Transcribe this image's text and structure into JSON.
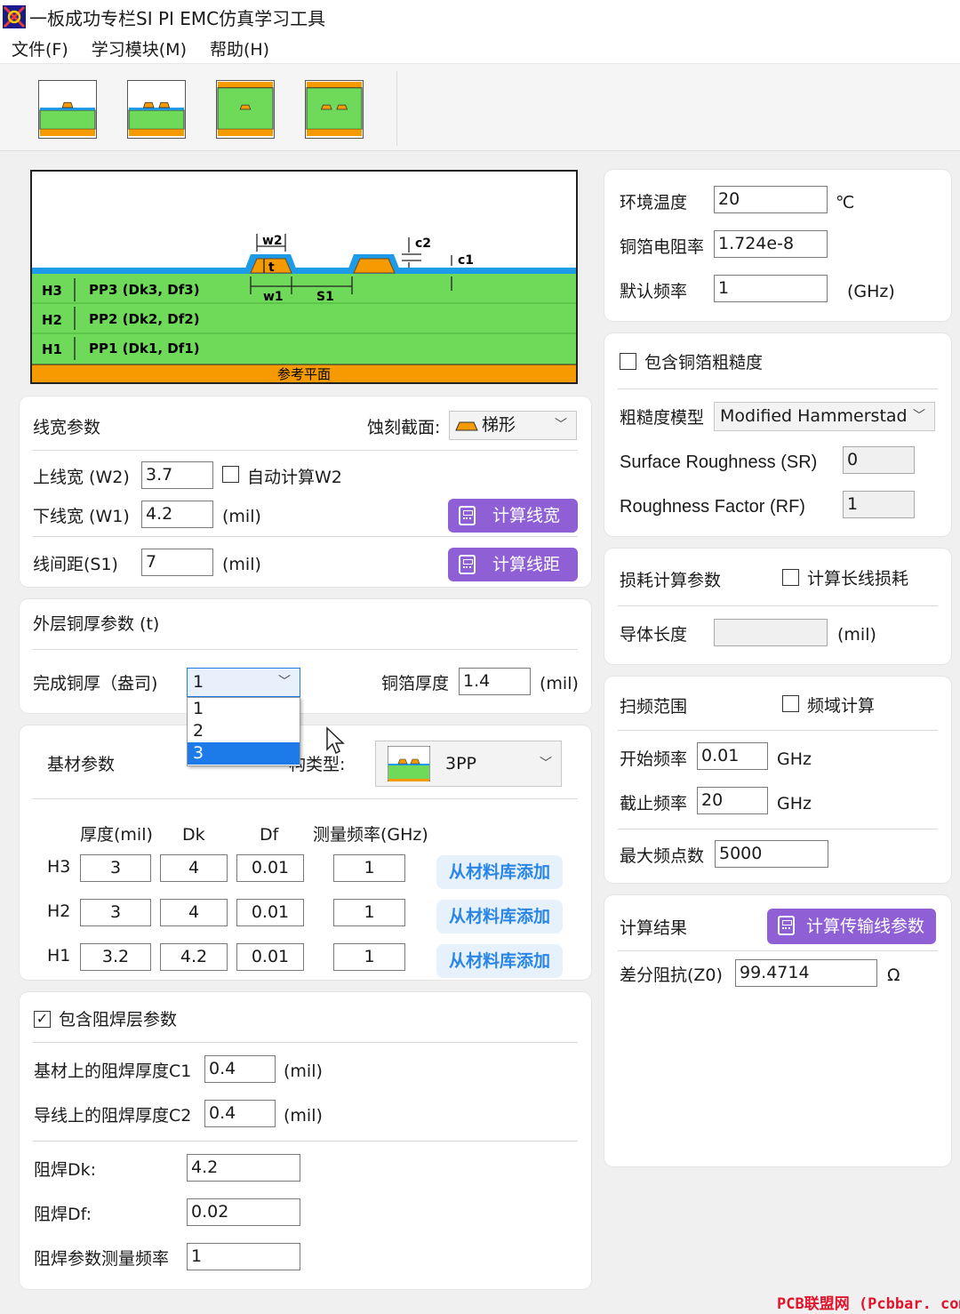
{
  "window": {
    "title": "一板成功专栏SI PI EMC仿真学习工具"
  },
  "menu": [
    "文件(F)",
    "学习模块(M)",
    "帮助(H)"
  ],
  "diagram": {
    "labels": {
      "w2": "w2",
      "t": "t",
      "c2": "c2",
      "c1": "c1",
      "w1": "w1",
      "s1": "S1"
    },
    "layers": [
      {
        "id": "H3",
        "name": "PP3 (Dk3, Df3)"
      },
      {
        "id": "H2",
        "name": "PP2 (Dk2, Df2)"
      },
      {
        "id": "H1",
        "name": "PP1 (Dk1, Df1)"
      }
    ],
    "ref_plane": "参考平面"
  },
  "line_width": {
    "title": "线宽参数",
    "etch_label": "蚀刻截面:",
    "etch_value": "梯形",
    "w2_label": "上线宽 (W2)",
    "w2_value": "3.7",
    "auto_w2": "自动计算W2",
    "w1_label": "下线宽 (W1)",
    "w1_value": "4.2",
    "unit": "(mil)",
    "calc_width": "计算线宽",
    "s1_label": "线间距(S1)",
    "s1_value": "7",
    "calc_spacing": "计算线距"
  },
  "copper": {
    "title": "外层铜厚参数 (t)",
    "finish_label": "完成铜厚（盎司)",
    "finish_value": "1",
    "foil_label": "铜箔厚度",
    "foil_value": "1.4",
    "unit": "(mil)",
    "dropdown_options": [
      "1",
      "2",
      "3"
    ]
  },
  "substrate": {
    "title": "基材参数",
    "structure_label": "叠构类型:",
    "structure_visible": "构类型:",
    "structure_value": "3PP",
    "columns": [
      "厚度(mil)",
      "Dk",
      "Df",
      "测量频率(GHz)"
    ],
    "rows": [
      {
        "layer": "H3",
        "thickness": "3",
        "dk": "4",
        "df": "0.01",
        "freq": "1"
      },
      {
        "layer": "H2",
        "thickness": "3",
        "dk": "4",
        "df": "0.01",
        "freq": "1"
      },
      {
        "layer": "H1",
        "thickness": "3.2",
        "dk": "4.2",
        "df": "0.01",
        "freq": "1"
      }
    ],
    "add_button": "从材料库添加"
  },
  "solder_mask": {
    "include": "包含阻焊层参数",
    "c1_label": "基材上的阻焊厚度C1",
    "c1_value": "0.4",
    "c2_label": "导线上的阻焊厚度C2",
    "c2_value": "0.4",
    "unit": "(mil)",
    "dk_label": "阻焊Dk:",
    "dk_value": "4.2",
    "df_label": "阻焊Df:",
    "df_value": "0.02",
    "freq_label": "阻焊参数测量频率",
    "freq_value": "1"
  },
  "environment": {
    "temp_label": "环境温度",
    "temp_value": "20",
    "temp_unit": "℃",
    "res_label": "铜箔电阻率",
    "res_value": "1.724e-8",
    "freq_label": "默认频率",
    "freq_value": "1",
    "freq_unit": "(GHz)"
  },
  "roughness": {
    "include": "包含铜箔粗糙度",
    "model_label": "粗糙度模型",
    "model_value": "Modified Hammerstad",
    "sr_label": "Surface Roughness (SR)",
    "sr_value": "0",
    "rf_label": "Roughness Factor (RF)",
    "rf_value": "1"
  },
  "loss": {
    "title": "损耗计算参数",
    "long_line": "计算长线损耗",
    "length_label": "导体长度",
    "length_value": "",
    "unit": "(mil)"
  },
  "sweep": {
    "title": "扫频范围",
    "freq_domain": "频域计算",
    "start_label": "开始频率",
    "start_value": "0.01",
    "stop_label": "截止频率",
    "stop_value": "20",
    "unit": "GHz",
    "points_label": "最大频点数",
    "points_value": "5000"
  },
  "result": {
    "title": "计算结果",
    "calc_button": "计算传输线参数",
    "z0_label": "差分阻抗(Z0)",
    "z0_value": "99.4714",
    "z0_unit": "Ω"
  },
  "watermark": "PCB联盟网 (Pcbbar. com)",
  "colors": {
    "accent": "#8f5fd6",
    "dielectric": "#6fd95a",
    "copper": "#f59a00",
    "soldermask": "#1e9be8"
  }
}
